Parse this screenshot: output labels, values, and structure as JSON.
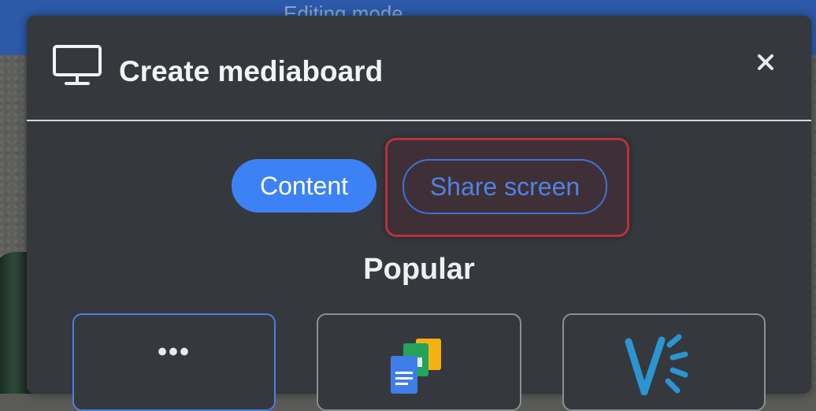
{
  "background": {
    "mode_label": "Editing mode"
  },
  "dialog": {
    "icon": "monitor-icon",
    "title": "Create mediaboard",
    "close_icon": "close-icon",
    "tabs": [
      {
        "label": "Content",
        "active": true
      },
      {
        "label": "Share screen",
        "active": false,
        "highlighted": true
      }
    ],
    "section_title": "Popular",
    "cards": [
      {
        "label": "•••",
        "icon": "more-icon",
        "selected": true
      },
      {
        "label": "",
        "icon": "google-docs-sheets-icon",
        "selected": false
      },
      {
        "label": "",
        "icon": "vimeo-style-icon",
        "selected": false
      }
    ]
  },
  "colors": {
    "accent": "#3c82f6",
    "highlight_border": "#b8323b",
    "dialog_bg": "#35383d"
  }
}
